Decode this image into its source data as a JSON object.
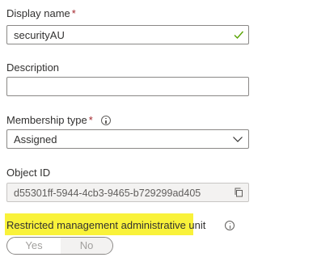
{
  "display_name": {
    "label": "Display name",
    "required_mark": "*",
    "value": "securityAU",
    "valid_icon": "checkmark-icon",
    "valid_color": "#57a300"
  },
  "description": {
    "label": "Description",
    "value": ""
  },
  "membership_type": {
    "label": "Membership type",
    "required_mark": "*",
    "info_icon": "info-icon",
    "selected": "Assigned",
    "dropdown_icon": "chevron-down-icon"
  },
  "object_id": {
    "label": "Object ID",
    "value": "d55301ff-5944-4cb3-9465-b729299ad405",
    "copy_icon": "copy-icon"
  },
  "restricted_unit": {
    "label": "Restricted management administrative unit",
    "info_icon": "info-icon",
    "highlight_color": "#f9f23a",
    "options": [
      "Yes",
      "No"
    ],
    "selected": "No"
  }
}
